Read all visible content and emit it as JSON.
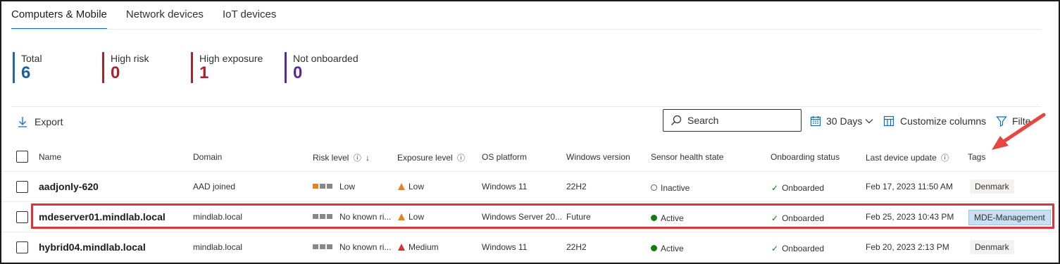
{
  "tabs": [
    {
      "label": "Computers & Mobile"
    },
    {
      "label": "Network devices"
    },
    {
      "label": "IoT devices"
    }
  ],
  "stats": {
    "total": {
      "label": "Total",
      "value": "6"
    },
    "high_risk": {
      "label": "High risk",
      "value": "0"
    },
    "high_exposure": {
      "label": "High exposure",
      "value": "1"
    },
    "not_onboarded": {
      "label": "Not onboarded",
      "value": "0"
    }
  },
  "toolbar": {
    "export_label": "Export",
    "search_label": "Search",
    "days_label": "30 Days",
    "customize_label": "Customize columns",
    "filter_label": "Filte"
  },
  "columns": {
    "name": "Name",
    "domain": "Domain",
    "risk": "Risk level",
    "exposure": "Exposure level",
    "os": "OS platform",
    "winver": "Windows version",
    "sensor": "Sensor health state",
    "onboarding": "Onboarding status",
    "last_update": "Last device update",
    "tags": "Tags"
  },
  "rows": [
    {
      "name": "aadjonly-620",
      "domain": "AAD joined",
      "risk": "Low",
      "exposure": "Low",
      "os": "Windows 11",
      "winver": "22H2",
      "sensor": "Inactive",
      "onboarding": "Onboarded",
      "last_update": "Feb 17, 2023 11:50 AM",
      "tag": "Denmark"
    },
    {
      "name": "mdeserver01.mindlab.local",
      "domain": "mindlab.local",
      "risk": "No known ri...",
      "exposure": "Low",
      "os": "Windows Server 20...",
      "winver": "Future",
      "sensor": "Active",
      "onboarding": "Onboarded",
      "last_update": "Feb 25, 2023 10:43 PM",
      "tag": "MDE-Management"
    },
    {
      "name": "hybrid04.mindlab.local",
      "domain": "mindlab.local",
      "risk": "No known ri...",
      "exposure": "Medium",
      "os": "Windows 11",
      "winver": "22H2",
      "sensor": "Active",
      "onboarding": "Onboarded",
      "last_update": "Feb 20, 2023 2:13 PM",
      "tag": "Denmark"
    }
  ],
  "colors": {
    "accent": "#0f6cbd",
    "risk_low": "#e8821e",
    "exposure_medium": "#d13438",
    "active": "#107c10",
    "highlight": "#d9363e"
  }
}
